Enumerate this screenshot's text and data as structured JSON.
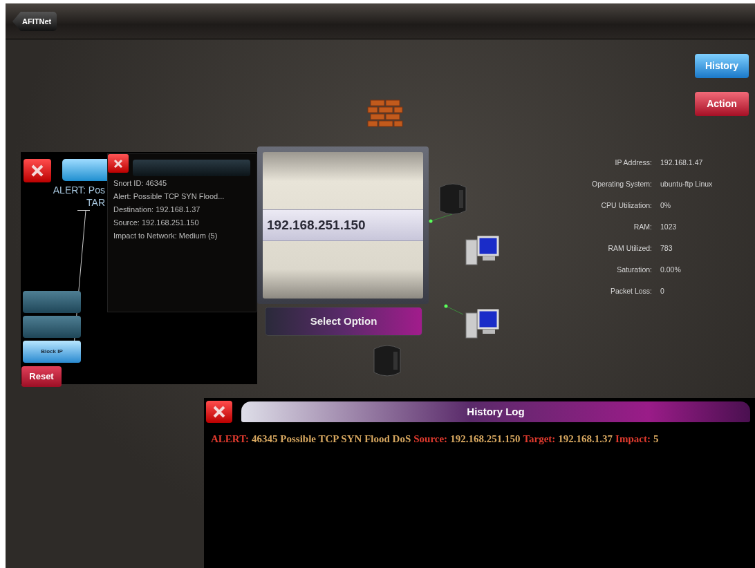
{
  "nav_bar": {
    "back_button": "AFITNet"
  },
  "side_buttons": [
    {
      "label": "History",
      "kind": "blue"
    },
    {
      "label": "Action",
      "kind": "red"
    }
  ],
  "left_panel": {
    "alert_lines": [
      "ALERT: Pos",
      "TAR"
    ],
    "action_buttons": [
      {
        "kind": "blank"
      },
      {
        "kind": "blank"
      },
      {
        "kind": "labeled",
        "label": "Block IP"
      }
    ],
    "reset_button": "Reset"
  },
  "snort_popup": {
    "lines": [
      "Snort ID: 46345",
      "Alert: Possible TCP SYN Flood...",
      "Destination: 192.168.1.37",
      "Source: 192.168.251.150",
      "Impact to Network: Medium (5)"
    ]
  },
  "picker": {
    "selected_value": "192.168.251.150",
    "button": "Select Option"
  },
  "host_info": [
    {
      "label": "IP Address:",
      "value": "192.168.1.47"
    },
    {
      "label": "Operating System:",
      "value": "ubuntu-ftp Linux"
    },
    {
      "label": "CPU Utilization:",
      "value": "0%"
    },
    {
      "label": "RAM:",
      "value": "1023"
    },
    {
      "label": "RAM Utilized:",
      "value": "783"
    },
    {
      "label": "Saturation:",
      "value": "0.00%"
    },
    {
      "label": "Packet Loss:",
      "value": "0"
    }
  ],
  "history_log": {
    "title": "History Log",
    "entries": [
      [
        {
          "kind": "label",
          "text": "ALERT:"
        },
        {
          "kind": "value",
          "text": "46345 Possible TCP SYN Flood DoS"
        },
        {
          "kind": "label",
          "text": "Source:"
        },
        {
          "kind": "value",
          "text": "192.168.251.150"
        },
        {
          "kind": "label",
          "text": "Target:"
        },
        {
          "kind": "value",
          "text": "192.168.1.37"
        },
        {
          "kind": "label",
          "text": "Impact:"
        },
        {
          "kind": "value",
          "text": "5"
        }
      ]
    ]
  }
}
